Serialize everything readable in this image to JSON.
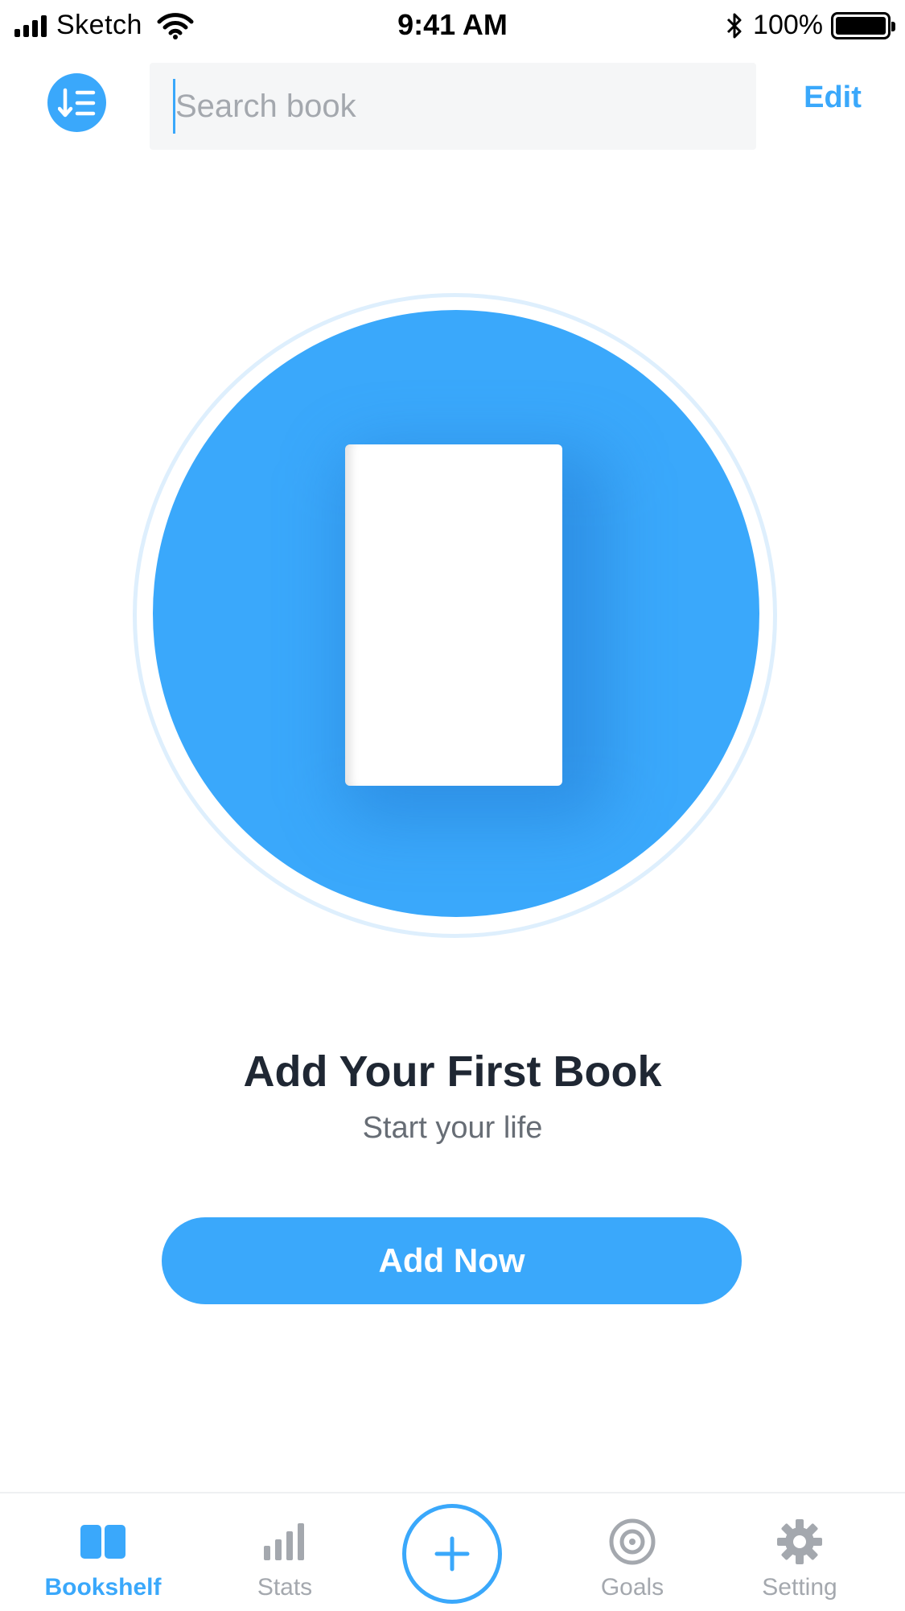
{
  "status_bar": {
    "carrier": "Sketch",
    "time": "9:41 AM",
    "battery": "100%",
    "icons": [
      "signal-icon",
      "wifi-icon",
      "bluetooth-icon",
      "battery-icon"
    ]
  },
  "top_bar": {
    "sort_icon": "sort-descending-list-icon",
    "search_placeholder": "Search book",
    "search_value": "",
    "edit_label": "Edit"
  },
  "empty_state": {
    "illustration": "book-icon",
    "title": "Add Your First Book",
    "subtitle": "Start your life",
    "button_label": "Add Now"
  },
  "tab_bar": {
    "tabs": [
      {
        "label": "Bookshelf",
        "icon": "bookshelf-icon",
        "active": true
      },
      {
        "label": "Stats",
        "icon": "bar-chart-icon",
        "active": false
      },
      {
        "label": "",
        "icon": "plus-icon",
        "active": false
      },
      {
        "label": "Goals",
        "icon": "target-icon",
        "active": false
      },
      {
        "label": "Setting",
        "icon": "gear-icon",
        "active": false
      }
    ]
  },
  "colors": {
    "accent": "#3aa8fb",
    "text_primary": "#1f2733",
    "text_secondary": "#676d75",
    "inactive": "#a4a8ae",
    "search_bg": "#f5f6f7",
    "ring": "#deeffd"
  }
}
